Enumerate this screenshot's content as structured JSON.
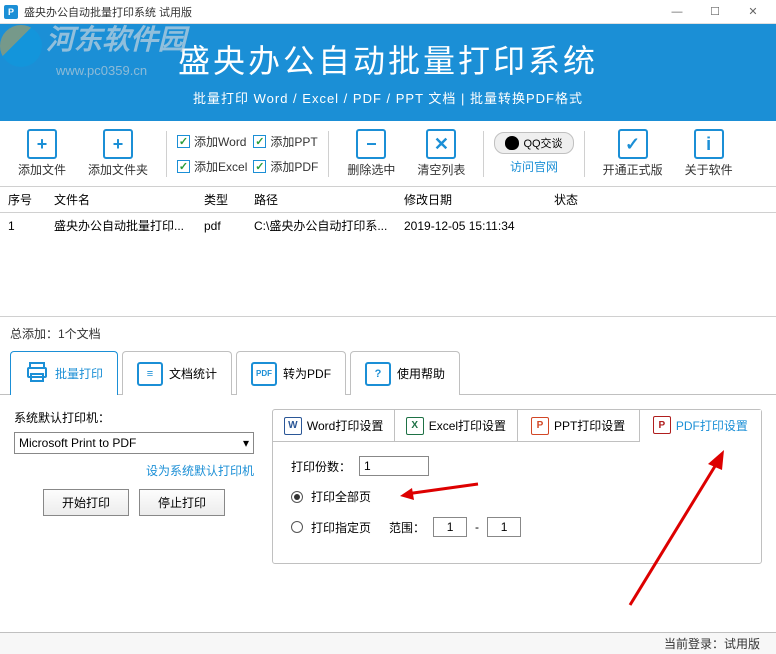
{
  "titlebar": {
    "title": "盛央办公自动批量打印系统 试用版"
  },
  "banner": {
    "main": "盛央办公自动批量打印系统",
    "sub": "批量打印 Word / Excel / PDF / PPT 文档  |  批量转换PDF格式"
  },
  "toolbar": {
    "add_file": "添加文件",
    "add_folder": "添加文件夹",
    "chk_word": "添加Word",
    "chk_excel": "添加Excel",
    "chk_ppt": "添加PPT",
    "chk_pdf": "添加PDF",
    "del_sel": "删除选中",
    "clear": "清空列表",
    "qq": "QQ交谈",
    "site": "访问官网",
    "upgrade": "开通正式版",
    "about": "关于软件"
  },
  "table": {
    "headers": {
      "no": "序号",
      "name": "文件名",
      "type": "类型",
      "path": "路径",
      "mtime": "修改日期",
      "status": "状态"
    },
    "rows": [
      {
        "no": "1",
        "name": "盛央办公自动批量打印...",
        "type": "pdf",
        "path": "C:\\盛央办公自动打印系...",
        "mtime": "2019-12-05 15:11:34",
        "status": ""
      }
    ]
  },
  "total": {
    "label": "总添加：1个文档"
  },
  "tabs": {
    "print": "批量打印",
    "stats": "文档统计",
    "topdf": "转为PDF",
    "help": "使用帮助"
  },
  "printer": {
    "label": "系统默认打印机：",
    "selected": "Microsoft Print to PDF",
    "set_default": "设为系统默认打印机",
    "start": "开始打印",
    "stop": "停止打印"
  },
  "subtabs": {
    "word": "Word打印设置",
    "excel": "Excel打印设置",
    "ppt": "PPT打印设置",
    "pdf": "PDF打印设置"
  },
  "pdf_settings": {
    "copies_label": "打印份数：",
    "copies_value": "1",
    "all_pages": "打印全部页",
    "range_pages": "打印指定页",
    "range_label": "范围：",
    "range_from": "1",
    "range_sep": "-",
    "range_to": "1"
  },
  "status": {
    "login": "当前登录：试用版"
  }
}
